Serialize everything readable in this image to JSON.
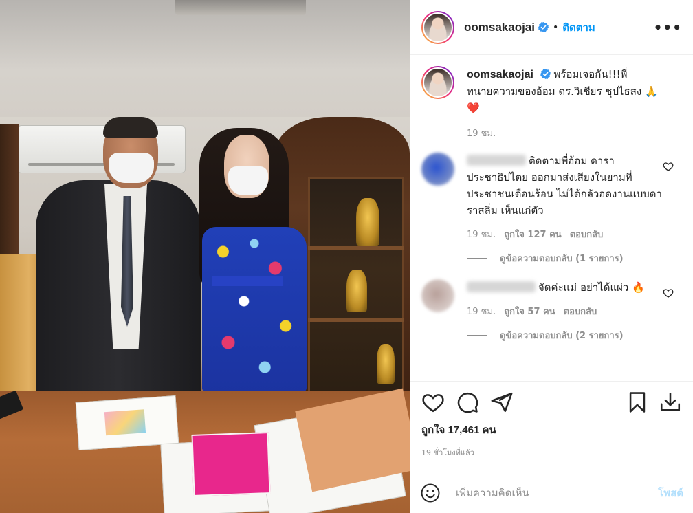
{
  "post": {
    "image_alt": "Photo of two people in masks standing in an office",
    "author": "oomsakaojai",
    "follow_label": "ติดตาม",
    "dot": "•",
    "more": "•••",
    "caption_author": "oomsakaojai",
    "caption": "พร้อมเจอกัน!!!พี่ทนายความของอ้อม ดร.วิเชียร ชุปไธสง 🙏❤️",
    "caption_time": "19 ชม.",
    "likes": "ถูกใจ 17,461 คน",
    "posted_ago": "19 ชั่วโมงที่แล้ว"
  },
  "comments": [
    {
      "text": "ติดตามพี่อ้อม ดาราประชาธิปไตย ออกมาส่งเสียงในยามที่ประชาชนเดือนร้อน ไม่ได้กลัวอดงานแบบดาราสลิ่ม เห็นแก่ตัว",
      "time": "19 ชม.",
      "likes": "ถูกใจ 127 คน",
      "reply": "ตอบกลับ",
      "view_replies": "ดูข้อความตอบกลับ (1 รายการ)"
    },
    {
      "text": "จัดค่ะแม่ อย่าได้แผ่ว 🔥",
      "time": "19 ชม.",
      "likes": "ถูกใจ 57 คน",
      "reply": "ตอบกลับ",
      "view_replies": "ดูข้อความตอบกลับ (2 รายการ)"
    }
  ],
  "composer": {
    "placeholder": "เพิ่มความคิดเห็น",
    "post_label": "โพสต์"
  },
  "colors": {
    "accent": "#0095f6",
    "muted": "#8e8e8e",
    "text": "#262626",
    "post_disabled": "#b2dffc"
  },
  "icons": [
    "verified-badge-icon",
    "more-options-icon",
    "heart-icon",
    "comment-icon",
    "share-icon",
    "bookmark-icon",
    "download-icon",
    "emoji-icon"
  ]
}
